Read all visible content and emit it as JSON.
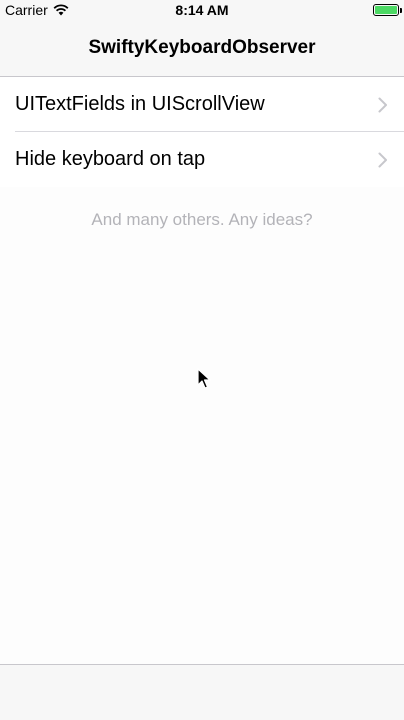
{
  "status_bar": {
    "carrier": "Carrier",
    "time": "8:14 AM",
    "battery_level": 1.0,
    "battery_color": "#4cd964"
  },
  "nav_bar": {
    "title": "SwiftyKeyboardObserver"
  },
  "menu": {
    "items": [
      {
        "label": "UITextFields in UIScrollView",
        "icon": "chevron-right-icon"
      },
      {
        "label": "Hide keyboard on tap",
        "icon": "chevron-right-icon"
      }
    ]
  },
  "footer_note": "And many others. Any ideas?",
  "colors": {
    "separator": "#c8c7cc",
    "chevron": "#c7c7cc",
    "muted_text": "#b3b3b8"
  }
}
